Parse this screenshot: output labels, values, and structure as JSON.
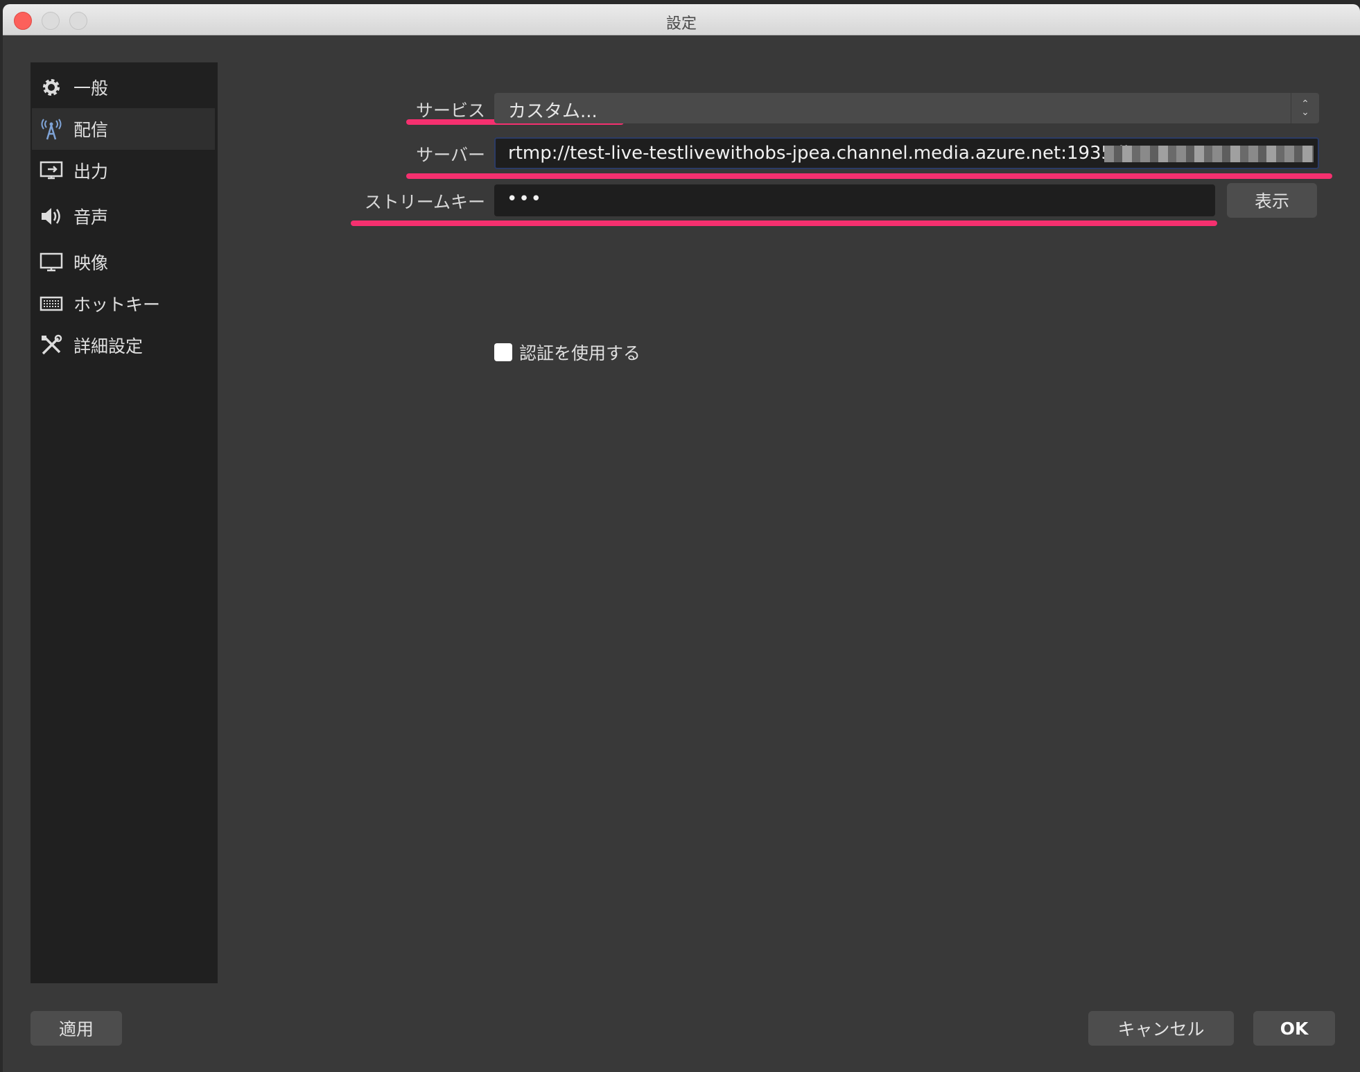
{
  "window": {
    "title": "設定"
  },
  "sidebar": {
    "items": [
      {
        "label": "一般",
        "icon": "gear-icon"
      },
      {
        "label": "配信",
        "icon": "antenna-icon",
        "active": true
      },
      {
        "label": "出力",
        "icon": "output-icon"
      },
      {
        "label": "音声",
        "icon": "speaker-icon"
      },
      {
        "label": "映像",
        "icon": "monitor-icon"
      },
      {
        "label": "ホットキー",
        "icon": "keyboard-icon"
      },
      {
        "label": "詳細設定",
        "icon": "tools-icon"
      }
    ]
  },
  "stream": {
    "service_label": "サービス",
    "service_value": "カスタム...",
    "server_label": "サーバー",
    "server_value": "rtmp://test-live-testlivewithobs-jpea.channel.media.azure.net:1935/live/",
    "key_label": "ストリームキー",
    "key_value": "•••",
    "show_button": "表示",
    "auth_label": "認証を使用する",
    "auth_checked": false
  },
  "footer": {
    "apply": "適用",
    "cancel": "キャンセル",
    "ok": "OK"
  },
  "colors": {
    "highlight_underline": "#f5306f",
    "sidebar_bg": "#202020",
    "panel_bg": "#393939"
  }
}
